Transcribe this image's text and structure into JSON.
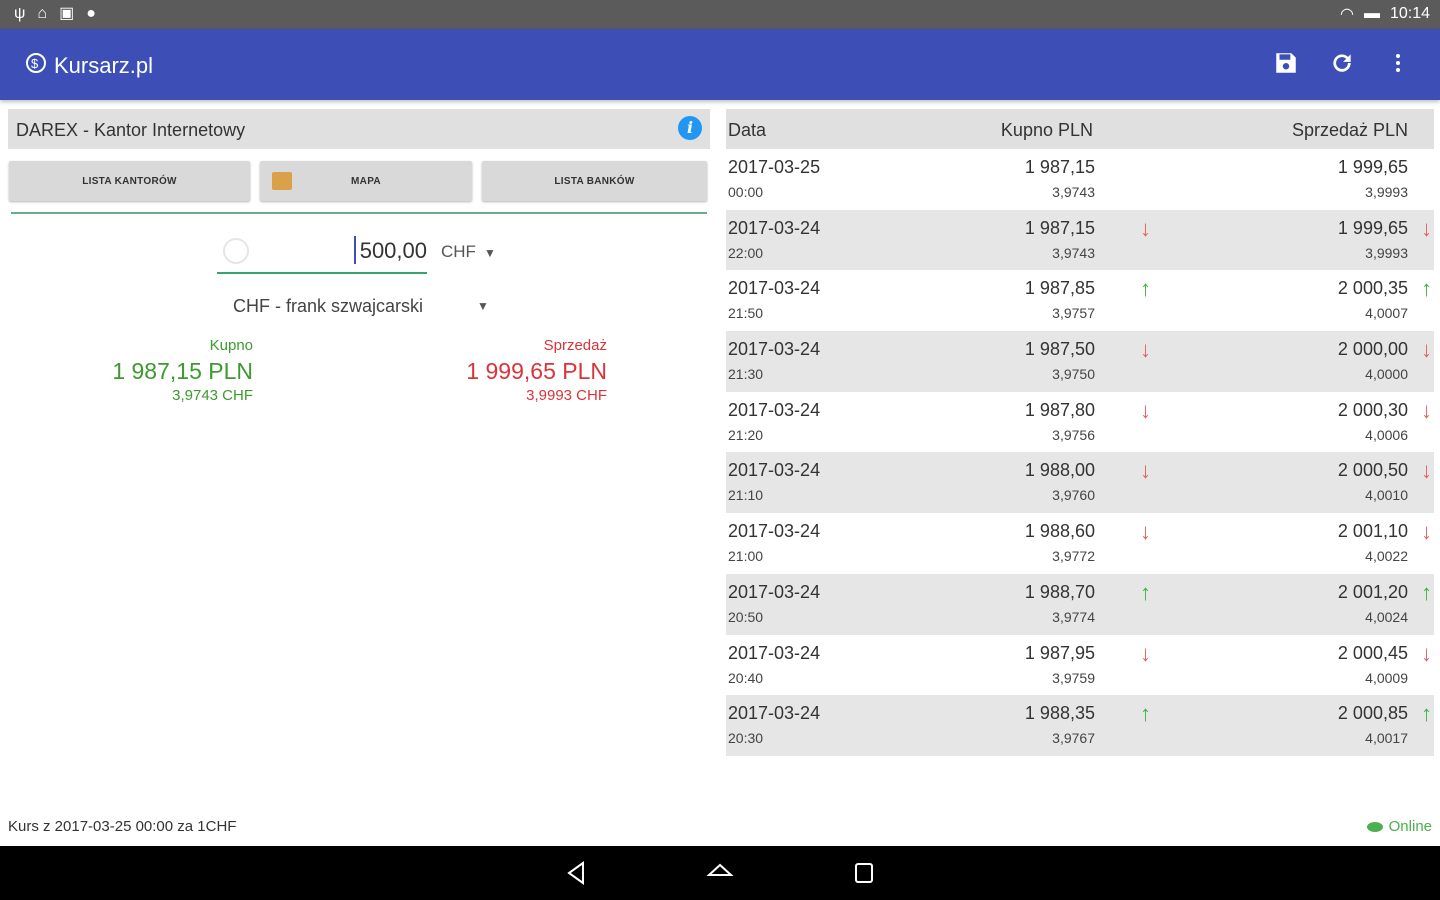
{
  "status_bar": {
    "time": "10:14",
    "left_icons": [
      "usb-icon",
      "home-icon",
      "screenshot-icon",
      "location-icon"
    ],
    "right_icons": [
      "wifi-icon",
      "battery-icon"
    ]
  },
  "app_bar": {
    "title": "Kursarz.pl",
    "actions": [
      "save-icon",
      "refresh-icon",
      "more-vert-icon"
    ],
    "background": "#3d4fb7"
  },
  "left": {
    "kantor_name": "DAREX - Kantor Internetowy",
    "buttons": {
      "lista_kantorow": "LISTA KANTORÓW",
      "mapa": "MAPA",
      "lista_bankow": "LISTA BANKÓW"
    },
    "amount": "500,00",
    "currency_code": "CHF",
    "currency_full": "CHF - frank szwajcarski",
    "kupno": {
      "label": "Kupno",
      "value": "1 987,15 PLN",
      "rate": "3,9743 CHF"
    },
    "sprzedaz": {
      "label": "Sprzedaż",
      "value": "1 999,65 PLN",
      "rate": "3,9993 CHF"
    }
  },
  "table": {
    "headers": {
      "data": "Data",
      "kupno": "Kupno PLN",
      "sprzedaz": "Sprzedaż PLN"
    },
    "rows": [
      {
        "date": "2017-03-25",
        "time": "00:00",
        "kupno": "1 987,15",
        "kupno_rate": "3,9743",
        "kupno_trend": "none",
        "sprzedaz": "1 999,65",
        "sprzedaz_rate": "3,9993",
        "sprzedaz_trend": "none"
      },
      {
        "date": "2017-03-24",
        "time": "22:00",
        "kupno": "1 987,15",
        "kupno_rate": "3,9743",
        "kupno_trend": "down",
        "sprzedaz": "1 999,65",
        "sprzedaz_rate": "3,9993",
        "sprzedaz_trend": "down"
      },
      {
        "date": "2017-03-24",
        "time": "21:50",
        "kupno": "1 987,85",
        "kupno_rate": "3,9757",
        "kupno_trend": "up",
        "sprzedaz": "2 000,35",
        "sprzedaz_rate": "4,0007",
        "sprzedaz_trend": "up"
      },
      {
        "date": "2017-03-24",
        "time": "21:30",
        "kupno": "1 987,50",
        "kupno_rate": "3,9750",
        "kupno_trend": "down",
        "sprzedaz": "2 000,00",
        "sprzedaz_rate": "4,0000",
        "sprzedaz_trend": "down"
      },
      {
        "date": "2017-03-24",
        "time": "21:20",
        "kupno": "1 987,80",
        "kupno_rate": "3,9756",
        "kupno_trend": "down",
        "sprzedaz": "2 000,30",
        "sprzedaz_rate": "4,0006",
        "sprzedaz_trend": "down"
      },
      {
        "date": "2017-03-24",
        "time": "21:10",
        "kupno": "1 988,00",
        "kupno_rate": "3,9760",
        "kupno_trend": "down",
        "sprzedaz": "2 000,50",
        "sprzedaz_rate": "4,0010",
        "sprzedaz_trend": "down"
      },
      {
        "date": "2017-03-24",
        "time": "21:00",
        "kupno": "1 988,60",
        "kupno_rate": "3,9772",
        "kupno_trend": "down",
        "sprzedaz": "2 001,10",
        "sprzedaz_rate": "4,0022",
        "sprzedaz_trend": "down"
      },
      {
        "date": "2017-03-24",
        "time": "20:50",
        "kupno": "1 988,70",
        "kupno_rate": "3,9774",
        "kupno_trend": "up",
        "sprzedaz": "2 001,20",
        "sprzedaz_rate": "4,0024",
        "sprzedaz_trend": "up"
      },
      {
        "date": "2017-03-24",
        "time": "20:40",
        "kupno": "1 987,95",
        "kupno_rate": "3,9759",
        "kupno_trend": "down",
        "sprzedaz": "2 000,45",
        "sprzedaz_rate": "4,0009",
        "sprzedaz_trend": "down"
      },
      {
        "date": "2017-03-24",
        "time": "20:30",
        "kupno": "1 988,35",
        "kupno_rate": "3,9767",
        "kupno_trend": "up",
        "sprzedaz": "2 000,85",
        "sprzedaz_rate": "4,0017",
        "sprzedaz_trend": "up"
      }
    ]
  },
  "footer": {
    "rate_info": "Kurs z 2017-03-25 00:00 za 1CHF",
    "status": "Online"
  },
  "colors": {
    "up": "#3fb33f",
    "down": "#e56060",
    "kupno": "#3c9a2e",
    "sprzedaz": "#d9343a"
  }
}
